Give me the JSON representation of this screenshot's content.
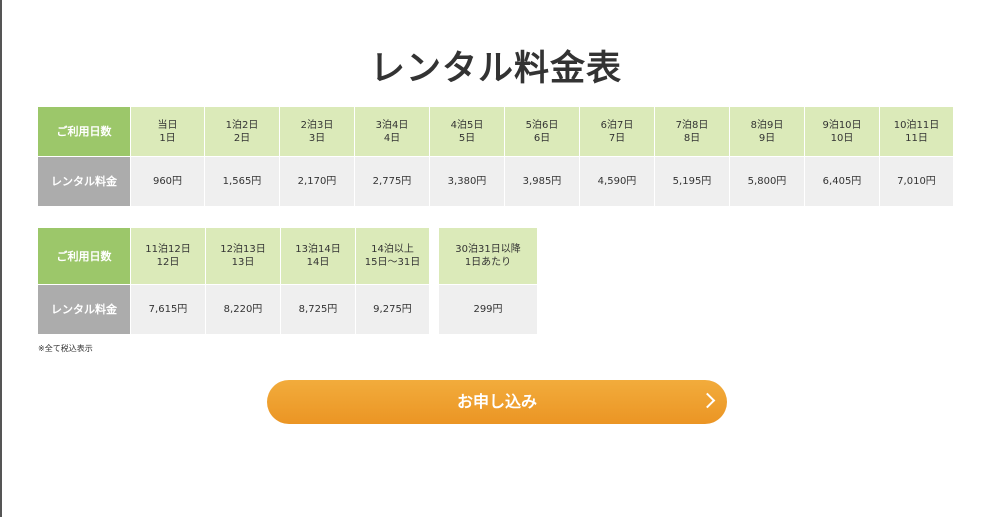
{
  "title": "レンタル料金表",
  "row_labels": {
    "days": "ご利用日数",
    "price": "レンタル料金"
  },
  "table1": {
    "days": [
      [
        "当日",
        "1日"
      ],
      [
        "1泊2日",
        "2日"
      ],
      [
        "2泊3日",
        "3日"
      ],
      [
        "3泊4日",
        "4日"
      ],
      [
        "4泊5日",
        "5日"
      ],
      [
        "5泊6日",
        "6日"
      ],
      [
        "6泊7日",
        "7日"
      ],
      [
        "7泊8日",
        "8日"
      ],
      [
        "8泊9日",
        "9日"
      ],
      [
        "9泊10日",
        "10日"
      ],
      [
        "10泊11日",
        "11日"
      ]
    ],
    "prices": [
      "960円",
      "1,565円",
      "2,170円",
      "2,775円",
      "3,380円",
      "3,985円",
      "4,590円",
      "5,195円",
      "5,800円",
      "6,405円",
      "7,010円"
    ]
  },
  "table2": {
    "days": [
      [
        "11泊12日",
        "12日"
      ],
      [
        "12泊13日",
        "13日"
      ],
      [
        "13泊14日",
        "14日"
      ],
      [
        "14泊以上",
        "15日〜31日"
      ]
    ],
    "prices": [
      "7,615円",
      "8,220円",
      "8,725円",
      "9,275円"
    ]
  },
  "table3": {
    "days": [
      "30泊31日以降",
      "1日あたり"
    ],
    "price": "299円"
  },
  "note": "※全て税込表示",
  "apply_button": "お申し込み",
  "colors": {
    "header_green": "#9cc76a",
    "header_gray": "#acacac",
    "cell_green": "#dbeab9",
    "cell_gray": "#efefef",
    "button_orange": "#f0a230"
  }
}
